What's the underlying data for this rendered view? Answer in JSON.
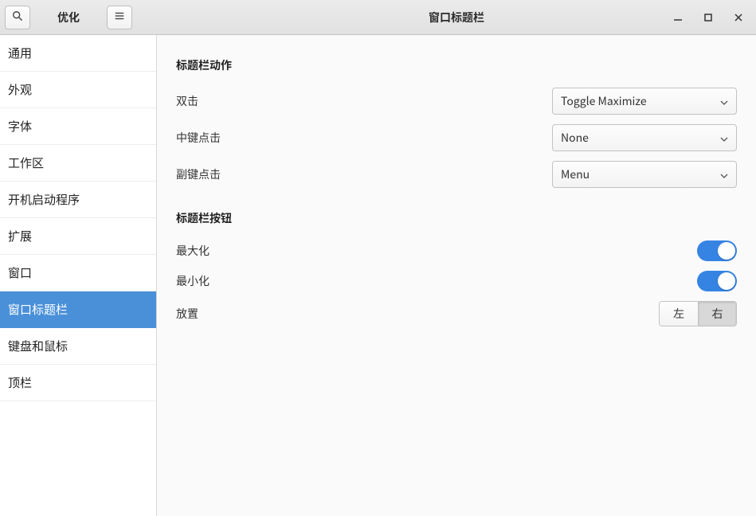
{
  "header": {
    "app_title": "优化",
    "page_title": "窗口标题栏"
  },
  "sidebar": {
    "items": [
      {
        "label": "通用",
        "active": false
      },
      {
        "label": "外观",
        "active": false
      },
      {
        "label": "字体",
        "active": false
      },
      {
        "label": "工作区",
        "active": false
      },
      {
        "label": "开机启动程序",
        "active": false
      },
      {
        "label": "扩展",
        "active": false
      },
      {
        "label": "窗口",
        "active": false
      },
      {
        "label": "窗口标题栏",
        "active": true
      },
      {
        "label": "键盘和鼠标",
        "active": false
      },
      {
        "label": "顶栏",
        "active": false
      }
    ]
  },
  "sections": {
    "actions": {
      "title": "标题栏动作",
      "double_click": {
        "label": "双击",
        "value": "Toggle Maximize"
      },
      "middle_click": {
        "label": "中键点击",
        "value": "None"
      },
      "secondary_click": {
        "label": "副键点击",
        "value": "Menu"
      }
    },
    "buttons": {
      "title": "标题栏按钮",
      "maximize": {
        "label": "最大化",
        "on": true
      },
      "minimize": {
        "label": "最小化",
        "on": true
      },
      "placement": {
        "label": "放置",
        "left": "左",
        "right": "右",
        "active": "right"
      }
    }
  }
}
